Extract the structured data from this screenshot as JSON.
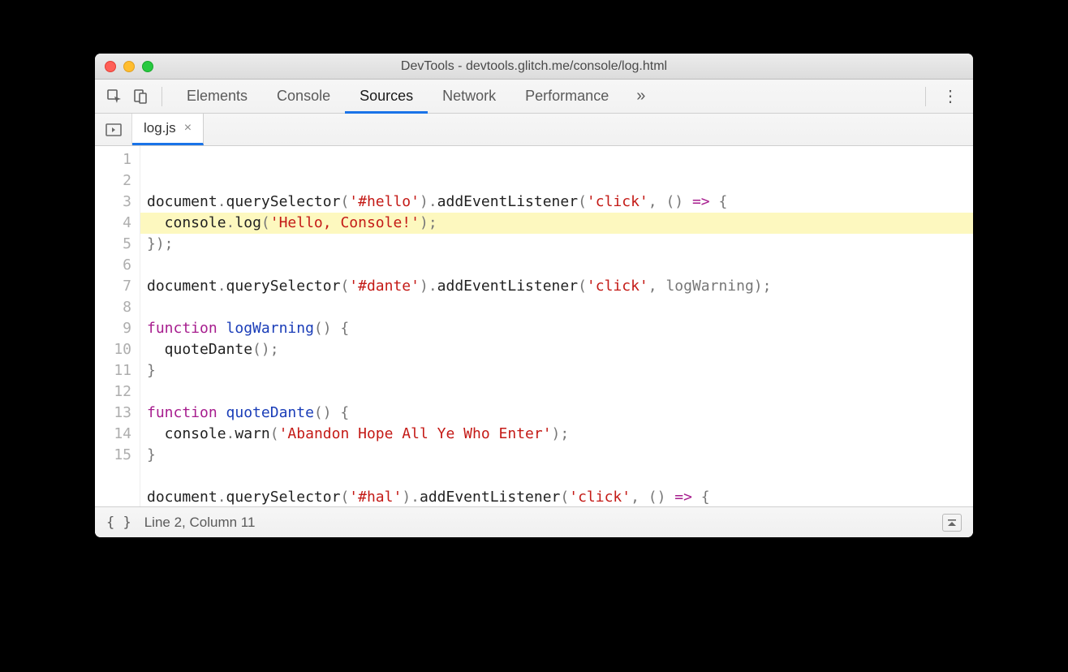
{
  "window": {
    "title": "DevTools - devtools.glitch.me/console/log.html"
  },
  "toolbar": {
    "tabs": [
      "Elements",
      "Console",
      "Sources",
      "Network",
      "Performance"
    ],
    "active_tab": "Sources",
    "more_glyph": "»"
  },
  "file_tab": {
    "name": "log.js",
    "close_glyph": "×"
  },
  "code": {
    "lines": [
      {
        "n": 1,
        "type": "plain",
        "tokens": [
          [
            "",
            "document"
          ],
          [
            "op",
            "."
          ],
          [
            "",
            "querySelector"
          ],
          [
            "op",
            "("
          ],
          [
            "str",
            "'#hello'"
          ],
          [
            "op",
            ")."
          ],
          [
            "",
            "addEventListener"
          ],
          [
            "op",
            "("
          ],
          [
            "str",
            "'click'"
          ],
          [
            "op",
            ", () "
          ],
          [
            "kw",
            "=>"
          ],
          [
            "op",
            " {"
          ]
        ]
      },
      {
        "n": 2,
        "type": "hl",
        "tokens": [
          [
            "",
            "  console"
          ],
          [
            "op",
            "."
          ],
          [
            "",
            "log"
          ],
          [
            "op",
            "("
          ],
          [
            "str",
            "'Hello, Console!'"
          ],
          [
            "op",
            ");"
          ]
        ]
      },
      {
        "n": 3,
        "type": "plain",
        "tokens": [
          [
            "op",
            "});"
          ]
        ]
      },
      {
        "n": 4,
        "type": "plain",
        "tokens": []
      },
      {
        "n": 5,
        "type": "plain",
        "tokens": [
          [
            "",
            "document"
          ],
          [
            "op",
            "."
          ],
          [
            "",
            "querySelector"
          ],
          [
            "op",
            "("
          ],
          [
            "str",
            "'#dante'"
          ],
          [
            "op",
            ")."
          ],
          [
            "",
            "addEventListener"
          ],
          [
            "op",
            "("
          ],
          [
            "str",
            "'click'"
          ],
          [
            "op",
            ", logWarning);"
          ]
        ]
      },
      {
        "n": 6,
        "type": "plain",
        "tokens": []
      },
      {
        "n": 7,
        "type": "plain",
        "tokens": [
          [
            "kw",
            "function "
          ],
          [
            "fn",
            "logWarning"
          ],
          [
            "op",
            "() {"
          ]
        ]
      },
      {
        "n": 8,
        "type": "plain",
        "tokens": [
          [
            "",
            "  quoteDante"
          ],
          [
            "op",
            "();"
          ]
        ]
      },
      {
        "n": 9,
        "type": "plain",
        "tokens": [
          [
            "op",
            "}"
          ]
        ]
      },
      {
        "n": 10,
        "type": "plain",
        "tokens": []
      },
      {
        "n": 11,
        "type": "plain",
        "tokens": [
          [
            "kw",
            "function "
          ],
          [
            "fn",
            "quoteDante"
          ],
          [
            "op",
            "() {"
          ]
        ]
      },
      {
        "n": 12,
        "type": "plain",
        "tokens": [
          [
            "",
            "  console"
          ],
          [
            "op",
            "."
          ],
          [
            "",
            "warn"
          ],
          [
            "op",
            "("
          ],
          [
            "str",
            "'Abandon Hope All Ye Who Enter'"
          ],
          [
            "op",
            ");"
          ]
        ]
      },
      {
        "n": 13,
        "type": "plain",
        "tokens": [
          [
            "op",
            "}"
          ]
        ]
      },
      {
        "n": 14,
        "type": "plain",
        "tokens": []
      },
      {
        "n": 15,
        "type": "plain",
        "tokens": [
          [
            "",
            "document"
          ],
          [
            "op",
            "."
          ],
          [
            "",
            "querySelector"
          ],
          [
            "op",
            "("
          ],
          [
            "str",
            "'#hal'"
          ],
          [
            "op",
            ")."
          ],
          [
            "",
            "addEventListener"
          ],
          [
            "op",
            "("
          ],
          [
            "str",
            "'click'"
          ],
          [
            "op",
            ", () "
          ],
          [
            "kw",
            "=>"
          ],
          [
            "op",
            " {"
          ]
        ]
      }
    ]
  },
  "status": {
    "format_glyph": "{ }",
    "position": "Line 2, Column 11"
  }
}
